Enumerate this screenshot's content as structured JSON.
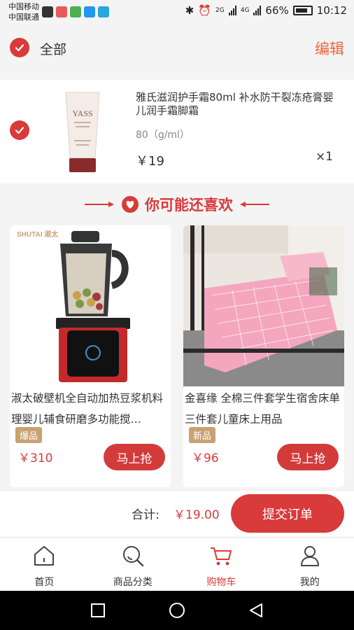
{
  "status_bar": {
    "carrier1": "中国移动",
    "carrier2": "中国联通",
    "network1": "2G",
    "network2": "4G",
    "battery": "66%",
    "time": "10:12"
  },
  "header": {
    "select_all_label": "全部",
    "edit_label": "编辑"
  },
  "cart_item": {
    "title": "雅氏滋润护手霜80ml 补水防干裂冻疮膏婴儿润手霜脚霜",
    "spec": "80（g/ml）",
    "price": "￥19",
    "quantity": "×1",
    "image_brand": "YASS"
  },
  "recommend": {
    "title": "你可能还喜欢",
    "products": [
      {
        "title": "淑太破壁机全自动加热豆浆机料理婴儿辅食研磨多功能搅…",
        "badge": "爆品",
        "price": "￥310",
        "buy_label": "马上抢",
        "image_brand": "SHUTAI 淑太"
      },
      {
        "title": "金喜缘 全棉三件套学生宿舍床单三件套儿童床上用品",
        "badge": "新品",
        "price": "￥96",
        "buy_label": "马上抢"
      }
    ]
  },
  "checkout": {
    "total_label": "合计:",
    "total_value": "￥19.00",
    "submit_label": "提交订单"
  },
  "tabs": [
    {
      "label": "首页",
      "icon": "home-icon"
    },
    {
      "label": "商品分类",
      "icon": "search-icon"
    },
    {
      "label": "购物车",
      "icon": "cart-icon",
      "active": true
    },
    {
      "label": "我的",
      "icon": "user-icon"
    }
  ],
  "colors": {
    "accent": "#d93a3a",
    "edit": "#e8663a",
    "badge": "#c8a272"
  }
}
